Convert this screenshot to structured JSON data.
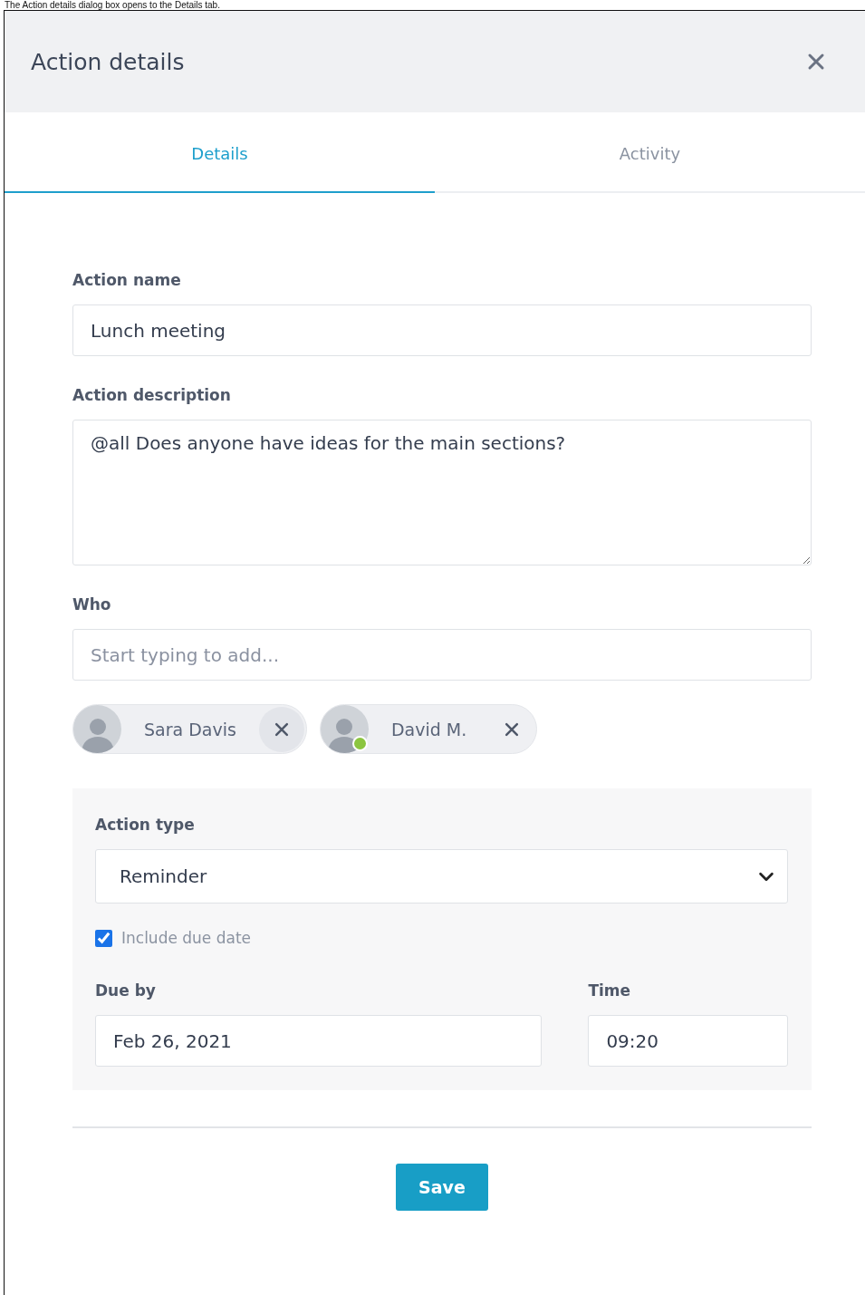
{
  "caption": "The Action details dialog box opens to the Details tab.",
  "dialog": {
    "title": "Action details"
  },
  "tabs": [
    {
      "label": "Details",
      "selected": true
    },
    {
      "label": "Activity",
      "selected": false
    }
  ],
  "action_name": {
    "label": "Action name",
    "value": "Lunch meeting"
  },
  "action_description": {
    "label": "Action description",
    "value": "@all Does anyone have ideas for the main sections?"
  },
  "who": {
    "label": "Who",
    "placeholder": "Start typing to add...",
    "people": [
      {
        "name": "Sara Davis",
        "online": false
      },
      {
        "name": "David M.",
        "online": true
      }
    ]
  },
  "action_type": {
    "label": "Action type",
    "value": "Reminder"
  },
  "include_due_date": {
    "label": "Include due date",
    "checked": true
  },
  "due_by": {
    "label": "Due by",
    "value": "Feb 26, 2021"
  },
  "time": {
    "label": "Time",
    "value": "09:20"
  },
  "buttons": [
    "Save"
  ]
}
